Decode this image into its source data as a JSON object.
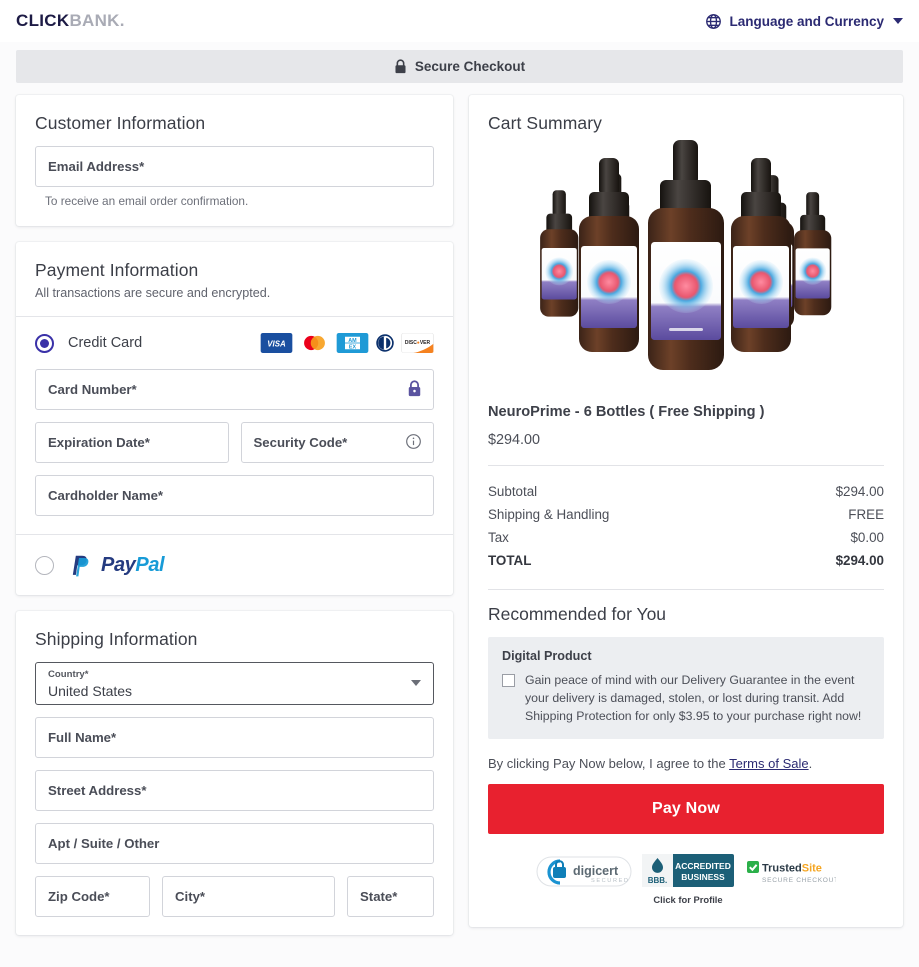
{
  "header": {
    "logo_click": "CLICK",
    "logo_bank": "BANK",
    "language_label": "Language and Currency",
    "globe_icon": "globe-icon",
    "chevron_icon": "chevron-down-icon"
  },
  "secure_band": {
    "label": "Secure Checkout",
    "lock_icon": "lock-icon"
  },
  "customer": {
    "title": "Customer Information",
    "email_placeholder": "Email Address*",
    "helper": "To receive an email order confirmation."
  },
  "payment": {
    "title": "Payment Information",
    "subtitle": "All transactions are secure and encrypted.",
    "credit_card_label": "Credit Card",
    "card_brands": [
      "VISA",
      "Mastercard",
      "AMEX",
      "Diners Club",
      "DISCOVER"
    ],
    "card_number_placeholder": "Card Number*",
    "card_number_icon": "lock-icon",
    "expiration_placeholder": "Expiration Date*",
    "security_code_placeholder": "Security Code*",
    "security_code_icon": "info-icon",
    "cardholder_placeholder": "Cardholder Name*",
    "paypal_pay": "Pay",
    "paypal_pal": "Pal"
  },
  "shipping": {
    "title": "Shipping Information",
    "country_label": "Country*",
    "country_value": "United States",
    "full_name_placeholder": "Full Name*",
    "street_placeholder": "Street Address*",
    "apt_placeholder": "Apt / Suite / Other",
    "zip_placeholder": "Zip Code*",
    "city_placeholder": "City*",
    "state_placeholder": "State*"
  },
  "cart": {
    "title": "Cart Summary",
    "product_name": "NeuroPrime - 6 Bottles ( Free Shipping )",
    "product_price": "$294.00",
    "product_image_alt": "neuroprime-six-bottles",
    "totals": [
      {
        "label": "Subtotal",
        "value": "$294.00"
      },
      {
        "label": "Shipping & Handling",
        "value": "FREE"
      },
      {
        "label": "Tax",
        "value": "$0.00"
      },
      {
        "label": "TOTAL",
        "value": "$294.00"
      }
    ]
  },
  "recommended": {
    "title": "Recommended for You",
    "offer_head": "Digital Product",
    "offer_text": "Gain peace of mind with our Delivery Guarantee in the event your delivery is damaged, stolen, or lost during transit. Add Shipping Protection for only $3.95 to your purchase right now!"
  },
  "footer": {
    "terms_prefix": "By clicking Pay Now below, I agree to the ",
    "terms_link": "Terms of Sale",
    "terms_suffix": ".",
    "pay_now": "Pay Now",
    "badges": [
      {
        "name": "digicert",
        "main": "digicert",
        "sub": "SECURED"
      },
      {
        "name": "bbb",
        "main": "ACCREDITED",
        "main2": "BUSINESS",
        "sub": "Click for Profile",
        "mark": "BBB."
      },
      {
        "name": "trustedsite",
        "main": "Trusted",
        "main2": "Site",
        "sub": "SECURE CHECKOUT"
      }
    ]
  },
  "colors": {
    "brand_navy": "#1d1b45",
    "accent_indigo": "#3a31a8",
    "pay_now_red": "#e8212f",
    "band_gray": "#e6e7ea",
    "page_bg": "#fbfbfc"
  }
}
